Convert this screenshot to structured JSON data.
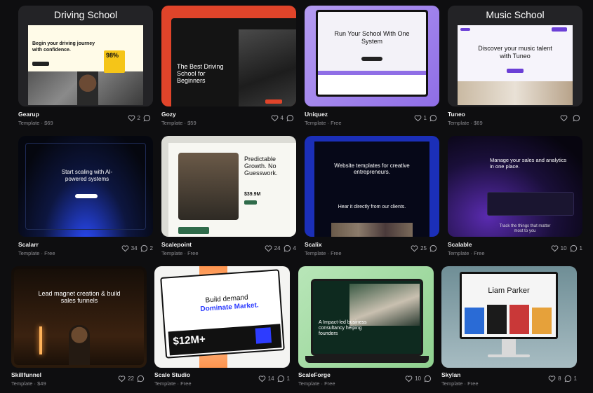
{
  "cards": [
    {
      "title": "Gearup",
      "sub": "Template · $69",
      "likes": "2",
      "comments": "",
      "banner": "Driving School"
    },
    {
      "title": "Gozy",
      "sub": "Template · $59",
      "likes": "4",
      "comments": ""
    },
    {
      "title": "Uniquez",
      "sub": "Template · Free",
      "likes": "1",
      "comments": ""
    },
    {
      "title": "Tuneo",
      "sub": "Template · $69",
      "likes": "",
      "comments": "",
      "banner": "Music School"
    },
    {
      "title": "Scalarr",
      "sub": "Template · Free",
      "likes": "34",
      "comments": "2"
    },
    {
      "title": "Scalepoint",
      "sub": "Template · Free",
      "likes": "24",
      "comments": "4"
    },
    {
      "title": "Scalix",
      "sub": "Template · Free",
      "likes": "25",
      "comments": ""
    },
    {
      "title": "Scalable",
      "sub": "Template · Free",
      "likes": "10",
      "comments": "1"
    },
    {
      "title": "Skillfunnel",
      "sub": "Template · $49",
      "likes": "22",
      "comments": ""
    },
    {
      "title": "Scale Studio",
      "sub": "Template · Free",
      "likes": "14",
      "comments": "1"
    },
    {
      "title": "ScaleForge",
      "sub": "Template · Free",
      "likes": "10",
      "comments": ""
    },
    {
      "title": "Skylan",
      "sub": "Template · Free",
      "likes": "8",
      "comments": "1"
    }
  ],
  "previews": {
    "gearup": {
      "headline": "Begin your driving journey with confidence.",
      "stat": "98%"
    },
    "gozy": {
      "headline": "The Best Driving School for Beginners"
    },
    "uniquez": {
      "headline": "Run Your School With One System"
    },
    "tuneo": {
      "headline": "Discover your music talent with Tuneo"
    },
    "scalarr": {
      "headline": "Start scaling with AI-powered systems"
    },
    "scalepoint": {
      "headline": "Predictable Growth. No Guesswork.",
      "stat": "$39.9M"
    },
    "scalix": {
      "headline": "Website templates for creative entrepreneurs.",
      "headline2": "Hear it directly from our clients."
    },
    "scalable": {
      "headline": "Manage your sales and analytics in one place.",
      "footer": "Track the things that matter most to you"
    },
    "skillfunnel": {
      "headline": "Lead magnet creation & build sales funnels"
    },
    "scalestudio": {
      "headline": "Build demand",
      "headline2": "Dominate Market.",
      "stat": "$12M+"
    },
    "scaleforge": {
      "headline": "A Impact-led business consultancy helping founders"
    },
    "skylan": {
      "headline": "Liam Parker"
    }
  }
}
